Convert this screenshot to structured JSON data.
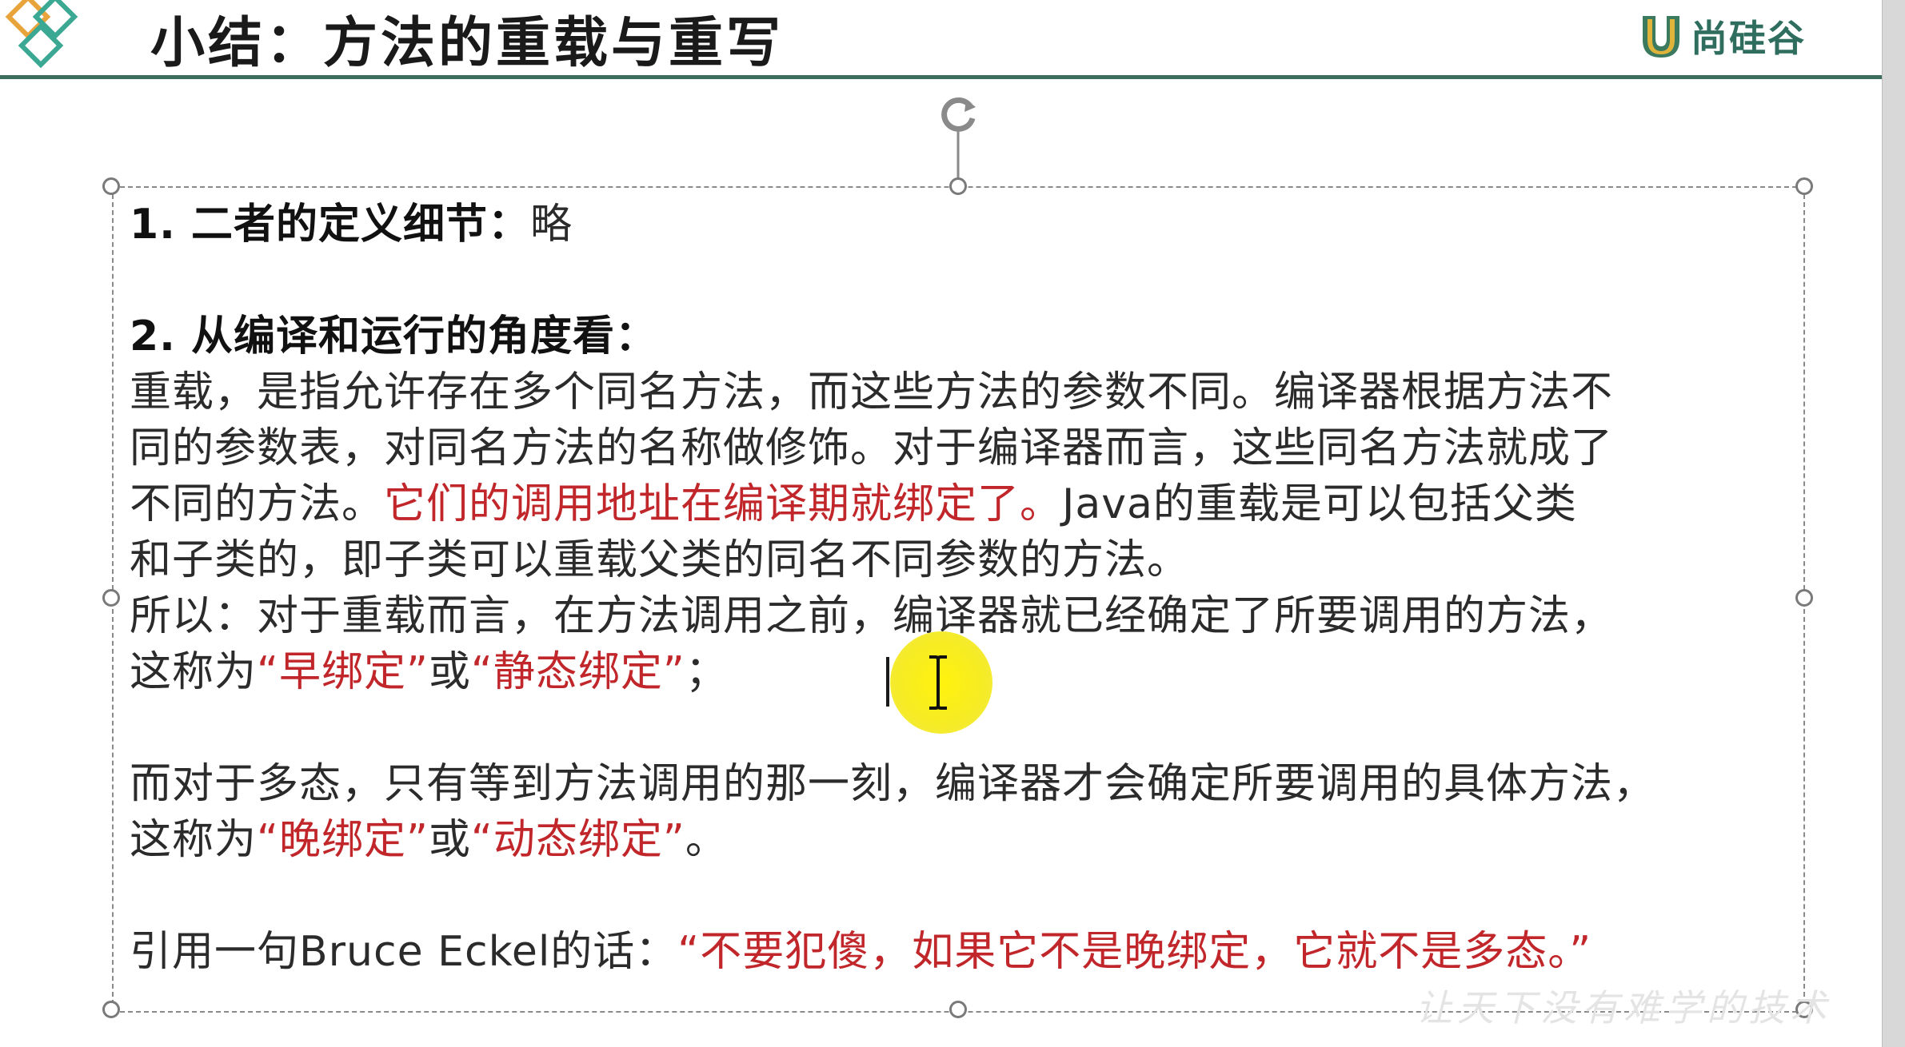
{
  "slide": {
    "title": "小结：方法的重载与重写",
    "brand": "尚硅谷",
    "watermark": "让天下没有难学的技术"
  },
  "body": {
    "l1_heading": "1.  二者的定义细节：",
    "l1_value": "略",
    "l2_heading": "2.  从编译和运行的角度看：",
    "p1_line1": "重载，是指允许存在多个同名方法，而这些方法的参数不同。编译器根据方法不",
    "p1_line2": "同的参数表，对同名方法的名称做修饰。对于编译器而言，这些同名方法就成了",
    "p1_line3_a": "不同的方法。",
    "p1_line3_hl": "它们的调用地址在编译期就绑定了。",
    "p1_line3_b": "Java的重载是可以包括父类",
    "p1_line4": "和子类的，即子类可以重载父类的同名不同参数的方法。",
    "p2_line1": "所以：对于重载而言，在方法调用之前，编译器就已经确定了所要调用的方法，",
    "p2_line2_a": "这称为",
    "p2_line2_hl1": "“早绑定”",
    "p2_line2_mid": "或",
    "p2_line2_hl2": "“静态绑定”",
    "p2_line2_end": "；",
    "p3_line1": "而对于多态，只有等到方法调用的那一刻，编译器才会确定所要调用的具体方法，",
    "p3_line2_a": "这称为",
    "p3_line2_hl1": "“晚绑定”",
    "p3_line2_mid": "或",
    "p3_line2_hl2": "“动态绑定”",
    "p3_line2_end": "。",
    "p4_a": "引用一句Bruce Eckel的话：",
    "p4_hl": "“不要犯傻，如果它不是晚绑定，它就不是多态。”"
  },
  "colors": {
    "accent_green": "#3c6e5c",
    "highlight_red": "#c0262a",
    "cursor_yellow": "#fff200"
  },
  "icons": {
    "logo": "teal-diamonds-logo",
    "brand_mark": "u-shield-icon",
    "rotate": "rotate-handle-icon",
    "mouse": "i-beam-cursor-icon"
  }
}
